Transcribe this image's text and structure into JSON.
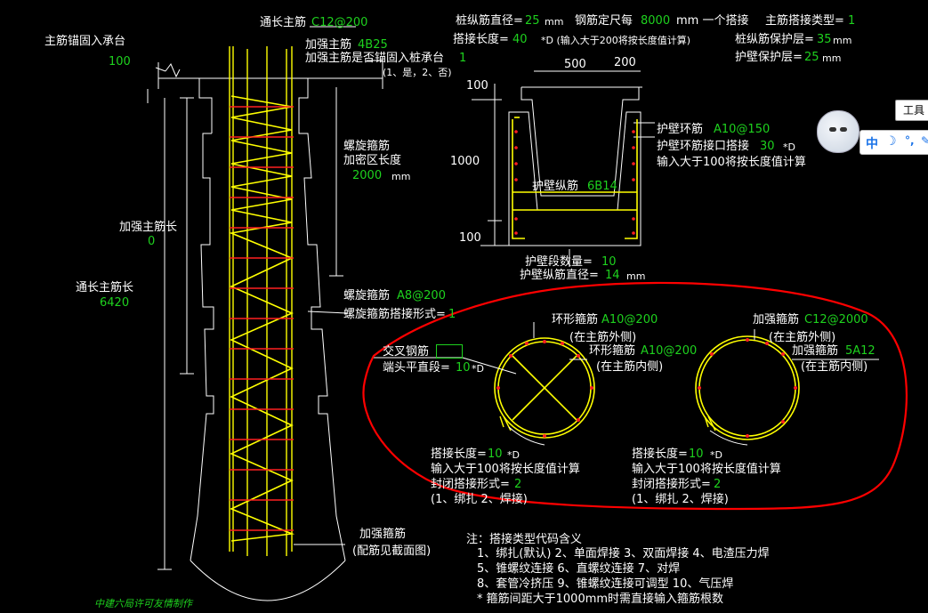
{
  "pile": {
    "main_anchor_label": "主筋锚固入承台",
    "main_anchor_value": "100",
    "through_main_rebar_label": "通长主筋",
    "through_main_rebar_value": "C12@200",
    "reinf_main_label": "加强主筋",
    "reinf_main_value": "4B25",
    "reinf_anchor_label": "加强主筋是否锚固入桩承台",
    "reinf_anchor_value": "1",
    "reinf_anchor_options": "(1、是，2、否)",
    "spiral_dense_label_1": "螺旋箍筋",
    "spiral_dense_label_2": "加密区长度",
    "spiral_dense_value": "2000",
    "spiral_dense_unit": "mm",
    "reinf_length_label": "加强主筋长",
    "reinf_length_value": "0",
    "through_length_label": "通长主筋长",
    "through_length_value": "6420",
    "spiral_stirrup_label": "螺旋箍筋",
    "spiral_stirrup_value": "A8@200",
    "spiral_lap_label": "螺旋箍筋搭接形式=",
    "spiral_lap_value": "1",
    "reinf_stirrup_label": "加强箍筋",
    "reinf_stirrup_note": "(配筋见截面图)",
    "credit": "中建六局许可友情制作"
  },
  "params": {
    "pile_rebar_dia_label": "桩纵筋直径=",
    "pile_rebar_dia_value": "25",
    "unit_mm": "mm",
    "rebar_length_label": "钢筋定尺每",
    "rebar_length_value": "8000",
    "rebar_length_suffix": "mm 一个搭接",
    "lap_type_label": "主筋搭接类型=",
    "lap_type_value": "1",
    "lap_length_label": "搭接长度=",
    "lap_length_value": "40",
    "lap_length_note": "*D (输入大于200将按长度值计算)",
    "cover_label": "桩纵筋保护层=",
    "cover_value": "35",
    "wall_cover_label": "护壁保护层=",
    "wall_cover_value": "25"
  },
  "wall": {
    "dim_500": "500",
    "dim_200": "200",
    "dim_100_top": "100",
    "dim_1000": "1000",
    "dim_100_bottom": "100",
    "ring_label": "护壁环筋",
    "ring_value": "A10@150",
    "ring_lap_label": "护壁环筋接口搭接",
    "ring_lap_value": "30",
    "ring_lap_unit": "*D",
    "ring_lap_note": "输入大于100将按长度值计算",
    "long_label": "护壁纵筋",
    "long_value": "6B14",
    "seg_count_label": "护壁段数量=",
    "seg_count_value": "10",
    "long_dia_label": "护壁纵筋直径=",
    "long_dia_value": "14",
    "long_dia_unit": "mm"
  },
  "section_left": {
    "cross_label": "交叉钢筋",
    "end_straight_label": "端头平直段=",
    "end_straight_value": "10",
    "end_straight_unit": "*D",
    "ring_outer_label": "环形箍筋",
    "ring_outer_value": "A10@200",
    "ring_outer_note": "(在主筋外侧)",
    "ring_inner_label": "环形箍筋",
    "ring_inner_value": "A10@200",
    "ring_inner_note": "(在主筋内侧)",
    "lap_label": "搭接长度=",
    "lap_value": "10",
    "lap_unit": "*D",
    "lap_note": "输入大于100将按长度值计算",
    "close_label": "封闭搭接形式=",
    "close_value": "2",
    "close_options": "(1、绑扎  2、焊接)"
  },
  "section_right": {
    "reinf_outer_label": "加强箍筋",
    "reinf_outer_value": "C12@2000",
    "reinf_outer_note": "(在主筋外侧)",
    "reinf_inner_label": "加强箍筋",
    "reinf_inner_value": "5A12",
    "reinf_inner_note": "(在主筋内侧)",
    "lap_label": "搭接长度=",
    "lap_value": "10",
    "lap_unit": "*D",
    "lap_note": "输入大于100将按长度值计算",
    "close_label": "封闭搭接形式=",
    "close_value": "2",
    "close_options": "(1、绑扎  2、焊接)"
  },
  "notes": {
    "title": "注：搭接类型代码含义",
    "line1": "1、绑扎(默认)    2、单面焊接    3、双面焊接    4、电渣压力焊",
    "line2": "5、锥螺纹连接    6、直螺纹连接    7、对焊",
    "line3": "8、套管冷挤压    9、锥螺纹连接可调型    10、气压焊",
    "line4": "* 箍筋间距大于1000mm时需直接输入箍筋根数"
  },
  "overlay": {
    "toolbar_label": "工具",
    "ime_label": "中",
    "avatar_icon": "assistant-avatar-icon"
  },
  "colors": {
    "background": "#000000",
    "line": "#ffffff",
    "value": "#1ed21e",
    "rebar": "#ffff00",
    "stirrup": "#ff2020",
    "annotation": "#ff0000"
  }
}
